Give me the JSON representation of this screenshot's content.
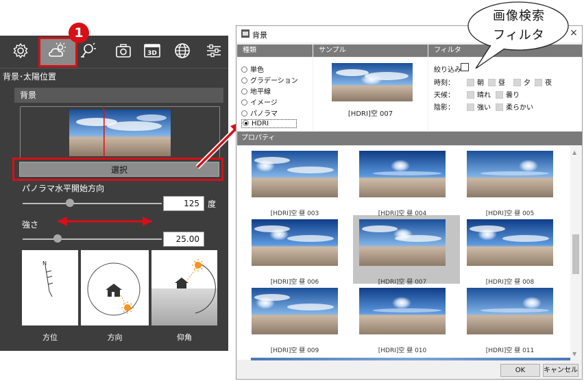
{
  "left_panel": {
    "section_title": "背景･太陽位置",
    "background_header": "背景",
    "select_button": "選択",
    "panorama_label": "パノラマ水平開始方向",
    "panorama_value": "125",
    "panorama_unit": "度",
    "panorama_level": 0.34,
    "strength_label": "強さ",
    "strength_value": "25.00",
    "strength_level": 0.25,
    "cards": [
      {
        "label": "方位"
      },
      {
        "label": "方向"
      },
      {
        "label": "仰角"
      }
    ],
    "toolbar_icons": [
      "gear-icon",
      "sun-cloud-icon",
      "light-bulb-icon",
      "camera-icon",
      "3d-view-icon",
      "globe-icon",
      "sliders-icon"
    ]
  },
  "dialog": {
    "title": "背景",
    "close": "×",
    "columns": {
      "kind": "種類",
      "sample": "サンプル",
      "filter": "フィルタ"
    },
    "kinds": [
      {
        "label": "単色",
        "selected": false
      },
      {
        "label": "グラデーション",
        "selected": false
      },
      {
        "label": "地平線",
        "selected": false
      },
      {
        "label": "イメージ",
        "selected": false
      },
      {
        "label": "パノラマ",
        "selected": false
      },
      {
        "label": "HDRI",
        "selected": true
      }
    ],
    "sample_caption": "[HDRI]空 007",
    "filter": {
      "narrow": "絞り込み",
      "time_label": "時刻：",
      "time_options": [
        "朝",
        "昼",
        "夕",
        "夜"
      ],
      "weather_label": "天候：",
      "weather_options": [
        "晴れ",
        "曇り"
      ],
      "shadow_label": "陰影：",
      "shadow_options": [
        "強い",
        "柔らかい"
      ]
    },
    "properties_header": "プロパティ",
    "thumbnails": [
      "[HDRI]空 昼 003",
      "[HDRI]空 昼 004",
      "[HDRI]空 昼 005",
      "[HDRI]空 昼 006",
      "[HDRI]空 昼 007",
      "[HDRI]空 昼 008",
      "[HDRI]空 昼 009",
      "[HDRI]空 昼 010",
      "[HDRI]空 昼 011"
    ],
    "selected_index": 4,
    "ok": "OK",
    "cancel": "キャンセル"
  },
  "annotations": {
    "badge": "1",
    "bubble_line1": "画像検索",
    "bubble_line2": "フィルタ"
  },
  "colors": {
    "accent_red": "#d80f16",
    "panel_dark": "#3d3d3d",
    "header_gray": "#7a7a7a"
  }
}
